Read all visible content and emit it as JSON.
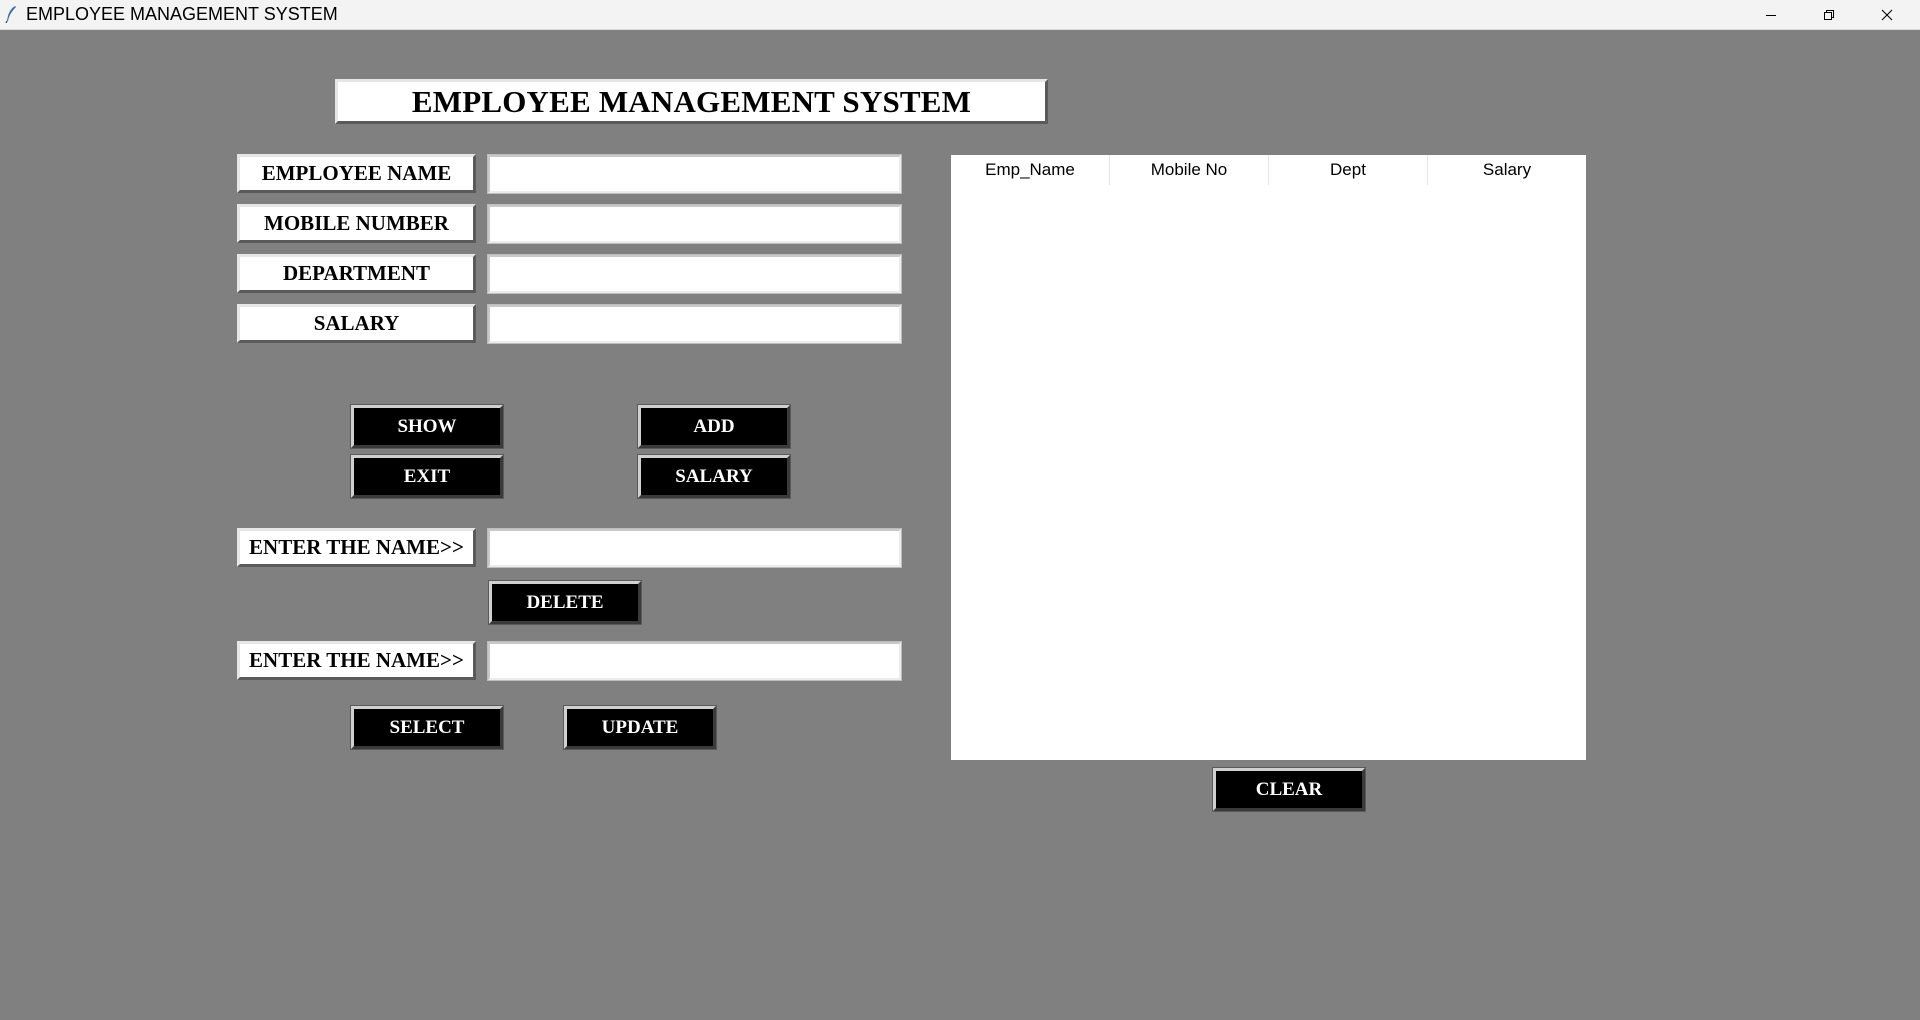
{
  "window": {
    "title": "EMPLOYEE MANAGEMENT SYSTEM",
    "controls": {
      "minimize_icon": "minimize-icon",
      "restore_icon": "restore-icon",
      "close_icon": "close-icon"
    }
  },
  "header": {
    "title": "EMPLOYEE MANAGEMENT SYSTEM"
  },
  "form": {
    "employee_name": {
      "label": "EMPLOYEE NAME",
      "value": ""
    },
    "mobile_number": {
      "label": "MOBILE NUMBER",
      "value": ""
    },
    "department": {
      "label": "DEPARTMENT",
      "value": ""
    },
    "salary": {
      "label": "SALARY",
      "value": ""
    }
  },
  "buttons": {
    "show": "SHOW",
    "add": "ADD",
    "exit": "EXIT",
    "salary": "SALARY",
    "delete": "DELETE",
    "select": "SELECT",
    "update": "UPDATE",
    "clear": "CLEAR"
  },
  "delete_section": {
    "label": "ENTER THE NAME>>",
    "value": ""
  },
  "update_section": {
    "label": "ENTER THE NAME>>",
    "value": ""
  },
  "table": {
    "columns": [
      "Emp_Name",
      "Mobile No",
      "Dept",
      "Salary"
    ],
    "rows": []
  },
  "colors": {
    "background": "#808080",
    "button_bg": "#000000",
    "button_fg": "#ffffff",
    "label_bg": "#ffffff"
  }
}
